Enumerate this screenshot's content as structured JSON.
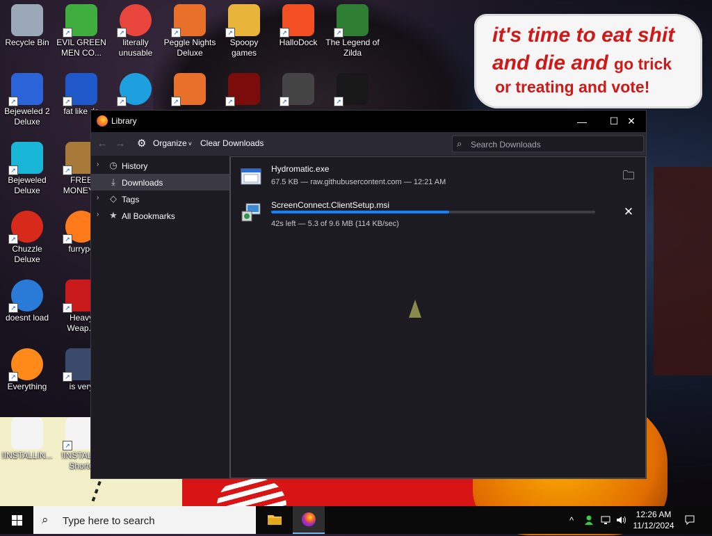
{
  "desktop": {
    "sticker": {
      "line1": "it's time to eat shit",
      "line2a": "and die and",
      "line2b": "go trick",
      "line3": "or treating and vote!"
    },
    "icons": [
      {
        "label": "Recycle Bin",
        "icon": "recycle-bin-icon",
        "color": "#9aa8b8"
      },
      {
        "label": "EVIL GREEN MEN CO...",
        "icon": "evil-green-men-icon",
        "color": "#3fae3f"
      },
      {
        "label": "literally unusable",
        "icon": "chrome-icon",
        "color": "#e8453c"
      },
      {
        "label": "Peggle Nights Deluxe",
        "icon": "peggle-icon",
        "color": "#e8702a"
      },
      {
        "label": "Spoopy games",
        "icon": "folder-icon",
        "color": "#e8b43a"
      },
      {
        "label": "HalloDock",
        "icon": "windows-shield-icon",
        "color": "#f25022"
      },
      {
        "label": "The Legend of Zilda",
        "icon": "zilda-icon",
        "color": "#2e7d32"
      },
      {
        "label": "Bejeweled 2 Deluxe",
        "icon": "bejeweled2-icon",
        "color": "#2a64d8"
      },
      {
        "label": "fat like da",
        "icon": "mpl-icon",
        "color": "#1f58c8"
      },
      {
        "label": "",
        "icon": "edge-icon",
        "color": "#1ea0e0"
      },
      {
        "label": "",
        "icon": "peggle-icon",
        "color": "#e8702a"
      },
      {
        "label": "",
        "icon": "flash-icon",
        "color": "#7a0c0c"
      },
      {
        "label": "",
        "icon": "hallodock-app-icon",
        "color": "#444444"
      },
      {
        "label": "",
        "icon": "yashma-icon",
        "color": "#181818"
      },
      {
        "label": "Bejeweled Deluxe",
        "icon": "diamond-icon",
        "color": "#19b6d8"
      },
      {
        "label": "FREE MONEY.e",
        "icon": "money-bag-icon",
        "color": "#a87a3a"
      },
      {
        "label": "Chuzzle Deluxe",
        "icon": "chuzzle-icon",
        "color": "#d82a1a"
      },
      {
        "label": "furrypo",
        "icon": "firefox-icon",
        "color": "#ff7a1a"
      },
      {
        "label": "doesnt load",
        "icon": "thunderbird-icon",
        "color": "#2a7ad8"
      },
      {
        "label": "Heavy Weap...",
        "icon": "radiation-icon",
        "color": "#c81a1a"
      },
      {
        "label": "Everything",
        "icon": "magnifier-icon",
        "color": "#ff8a1a"
      },
      {
        "label": "is very",
        "icon": "mpl-shield-icon",
        "color": "#3a4a6a"
      },
      {
        "label": "!INSTALLIN...",
        "icon": "text-file-icon",
        "color": "#f4f4f4"
      },
      {
        "label": "!INSTALL - Shorto",
        "icon": "text-file-icon",
        "color": "#f4f4f4"
      }
    ]
  },
  "window": {
    "title": "Library",
    "minimize": "—",
    "maximize": "☐",
    "close": "✕"
  },
  "toolbar": {
    "back": "←",
    "forward": "→",
    "organize_label": "Organize",
    "organize_caret": "˅",
    "clear_label": "Clear Downloads",
    "search_placeholder": "Search Downloads"
  },
  "sidebar": {
    "items": [
      {
        "label": "History",
        "twisty": "›",
        "icon": "◷"
      },
      {
        "label": "Downloads",
        "twisty": "",
        "icon": "⤓"
      },
      {
        "label": "Tags",
        "twisty": "›",
        "icon": "◇"
      },
      {
        "label": "All Bookmarks",
        "twisty": "›",
        "icon": "★"
      }
    ]
  },
  "downloads": [
    {
      "name": "Hydromatic.exe",
      "meta": "67.5 KB — raw.githubusercontent.com — 12:21 AM",
      "action_icon": "folder-icon",
      "action_glyph": "🗀"
    },
    {
      "name": "ScreenConnect.ClientSetup.msi",
      "meta": "42s left — 5.3 of 9.6 MB (114 KB/sec)",
      "progress": 0.55,
      "action_icon": "cancel-icon",
      "action_glyph": "✕"
    }
  ],
  "taskbar": {
    "search_placeholder": "Type here to search",
    "tray_chevron": "^",
    "time": "12:26 AM",
    "date": "11/12/2024",
    "accent": "#76b9ed"
  }
}
